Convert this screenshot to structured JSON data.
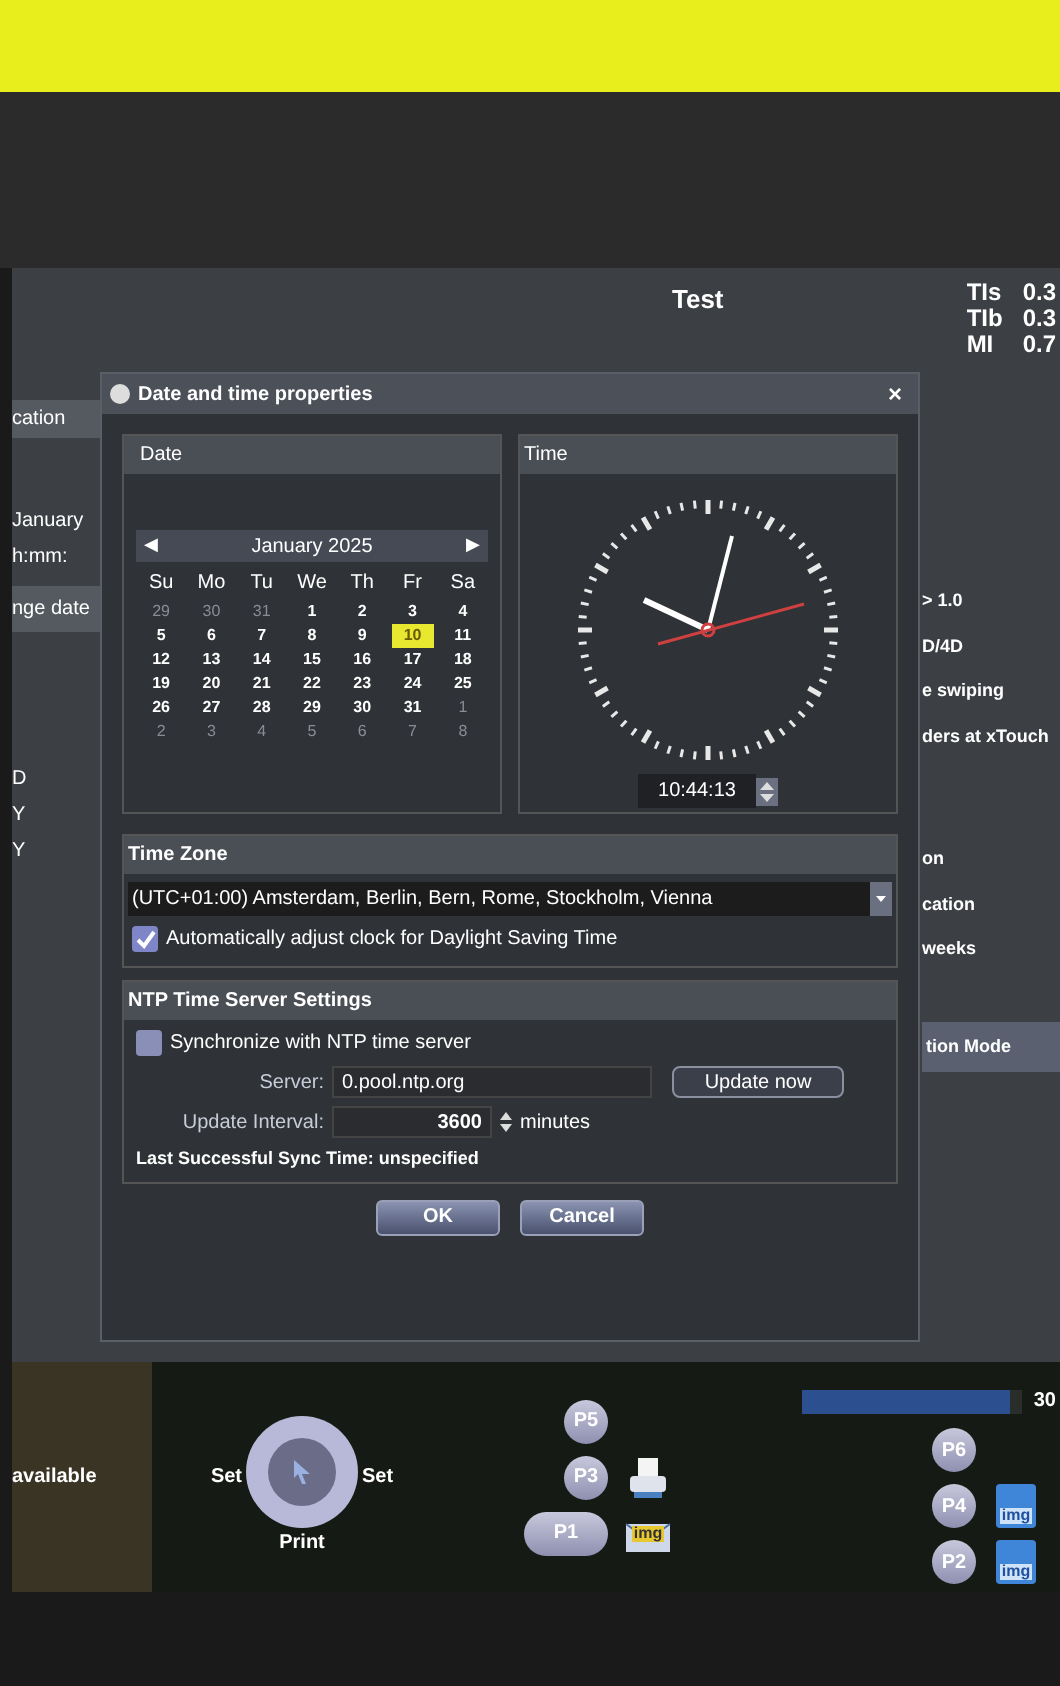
{
  "header": {
    "title": "Test",
    "indices": [
      {
        "label": "TIs",
        "value": "0.3"
      },
      {
        "label": "TIb",
        "value": "0.3"
      },
      {
        "label": "MI",
        "value": "0.7"
      }
    ]
  },
  "left_panel": {
    "heading": "cation",
    "items": [
      "January",
      "h:mm:"
    ],
    "button": "nge date",
    "letters": [
      "D",
      "Y",
      "Y"
    ]
  },
  "right_panel": {
    "items": [
      "> 1.0",
      "D/4D",
      "e swiping",
      "ders at xTouch"
    ],
    "items_2": [
      "on",
      "cation",
      "weeks"
    ],
    "button": "tion Mode"
  },
  "dialog": {
    "title": "Date and time properties",
    "close": "×",
    "date": {
      "heading": "Date",
      "prev": "◀",
      "month": "January 2025",
      "next": "▶",
      "weekdays": [
        "Su",
        "Mo",
        "Tu",
        "We",
        "Th",
        "Fr",
        "Sa"
      ],
      "weeks": [
        [
          {
            "day": "29",
            "other_month": true,
            "selected": false
          },
          {
            "day": "30",
            "other_month": true,
            "selected": false
          },
          {
            "day": "31",
            "other_month": true,
            "selected": false
          },
          {
            "day": "1",
            "other_month": false,
            "selected": false
          },
          {
            "day": "2",
            "other_month": false,
            "selected": false
          },
          {
            "day": "3",
            "other_month": false,
            "selected": false
          },
          {
            "day": "4",
            "other_month": false,
            "selected": false
          }
        ],
        [
          {
            "day": "5",
            "other_month": false,
            "selected": false
          },
          {
            "day": "6",
            "other_month": false,
            "selected": false
          },
          {
            "day": "7",
            "other_month": false,
            "selected": false
          },
          {
            "day": "8",
            "other_month": false,
            "selected": false
          },
          {
            "day": "9",
            "other_month": false,
            "selected": false
          },
          {
            "day": "10",
            "other_month": false,
            "selected": true
          },
          {
            "day": "11",
            "other_month": false,
            "selected": false
          }
        ],
        [
          {
            "day": "12",
            "other_month": false,
            "selected": false
          },
          {
            "day": "13",
            "other_month": false,
            "selected": false
          },
          {
            "day": "14",
            "other_month": false,
            "selected": false
          },
          {
            "day": "15",
            "other_month": false,
            "selected": false
          },
          {
            "day": "16",
            "other_month": false,
            "selected": false
          },
          {
            "day": "17",
            "other_month": false,
            "selected": false
          },
          {
            "day": "18",
            "other_month": false,
            "selected": false
          }
        ],
        [
          {
            "day": "19",
            "other_month": false,
            "selected": false
          },
          {
            "day": "20",
            "other_month": false,
            "selected": false
          },
          {
            "day": "21",
            "other_month": false,
            "selected": false
          },
          {
            "day": "22",
            "other_month": false,
            "selected": false
          },
          {
            "day": "23",
            "other_month": false,
            "selected": false
          },
          {
            "day": "24",
            "other_month": false,
            "selected": false
          },
          {
            "day": "25",
            "other_month": false,
            "selected": false
          }
        ],
        [
          {
            "day": "26",
            "other_month": false,
            "selected": false
          },
          {
            "day": "27",
            "other_month": false,
            "selected": false
          },
          {
            "day": "28",
            "other_month": false,
            "selected": false
          },
          {
            "day": "29",
            "other_month": false,
            "selected": false
          },
          {
            "day": "30",
            "other_month": false,
            "selected": false
          },
          {
            "day": "31",
            "other_month": false,
            "selected": false
          },
          {
            "day": "1",
            "other_month": true,
            "selected": false
          }
        ],
        [
          {
            "day": "2",
            "other_month": true,
            "selected": false
          },
          {
            "day": "3",
            "other_month": true,
            "selected": false
          },
          {
            "day": "4",
            "other_month": true,
            "selected": false
          },
          {
            "day": "5",
            "other_month": true,
            "selected": false
          },
          {
            "day": "6",
            "other_month": true,
            "selected": false
          },
          {
            "day": "7",
            "other_month": true,
            "selected": false
          },
          {
            "day": "8",
            "other_month": true,
            "selected": false
          }
        ]
      ]
    },
    "time": {
      "heading": "Time",
      "value": "10:44:13"
    },
    "time_zone": {
      "heading": "Time Zone",
      "value": "(UTC+01:00) Amsterdam, Berlin, Bern, Rome, Stockholm, Vienna",
      "dst_label": "Automatically adjust clock for Daylight Saving Time",
      "dst_checked": true
    },
    "ntp": {
      "heading": "NTP Time Server Settings",
      "sync_label": "Synchronize with NTP time server",
      "sync_checked": false,
      "server_label": "Server:",
      "server_value": "0.pool.ntp.org",
      "update_button": "Update now",
      "interval_label": "Update Interval:",
      "interval_value": "3600",
      "interval_unit": "minutes",
      "last_sync": "Last Successful Sync Time: unspecified"
    },
    "buttons": [
      "OK",
      "Cancel"
    ]
  },
  "bottom_panel": {
    "status": "available",
    "trackball": {
      "left": "Set",
      "right": "Set",
      "bottom": "Print"
    },
    "keys_left": [
      {
        "label": "P5",
        "wide": false
      },
      {
        "label": "P3",
        "wide": false,
        "kind": "printer"
      },
      {
        "label": "P1",
        "wide": true,
        "kind": "mail",
        "icon_text": "img"
      }
    ],
    "progress": {
      "level": 0.95,
      "reading": "30"
    },
    "keys_right": [
      {
        "label": "P6",
        "wide": false
      },
      {
        "label": "P4",
        "wide": false,
        "kind": "floppy",
        "icon_text": "img"
      },
      {
        "label": "P2",
        "wide": false,
        "kind": "floppy",
        "icon_text": "img"
      }
    ]
  }
}
